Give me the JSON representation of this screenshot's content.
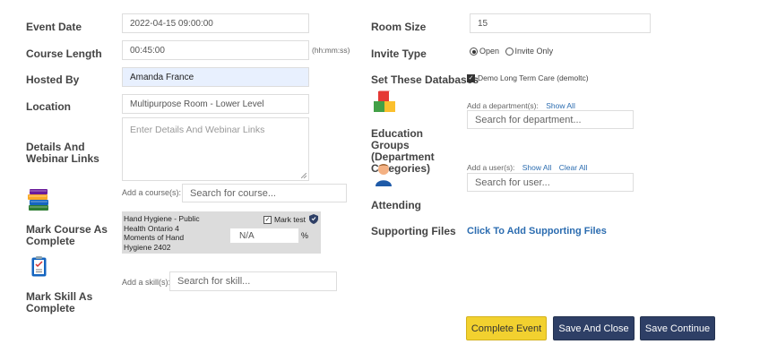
{
  "labels": {
    "event_date": "Event Date",
    "course_length": "Course Length",
    "hosted_by": "Hosted By",
    "location": "Location",
    "details": "Details And Webinar Links",
    "mark_course": "Mark Course As Complete",
    "mark_skill": "Mark Skill As Complete",
    "room_size": "Room Size",
    "invite_type": "Invite Type",
    "set_databases": "Set These Databases",
    "education_groups": "Education Groups (Department Categories)",
    "attending": "Attending",
    "supporting_files": "Supporting Files"
  },
  "fields": {
    "event_date": "2022-04-15 09:00:00",
    "course_length": "00:45:00",
    "course_length_hint": "(hh:mm:ss)",
    "hosted_by": "Amanda France",
    "location": "Multipurpose Room - Lower Level",
    "details_placeholder": "Enter Details And Webinar Links",
    "room_size": "15"
  },
  "course": {
    "add_label": "Add a course(s):",
    "search_placeholder": "Search for course...",
    "item_name": "Hand Hygiene - Public Health Ontario 4 Moments of Hand Hygiene 2402",
    "mark_test_label": "Mark test",
    "score_value": "N/A",
    "score_unit": "%"
  },
  "skill": {
    "add_label": "Add a skill(s):",
    "search_placeholder": "Search for skill..."
  },
  "invite": {
    "open": "Open",
    "invite_only": "Invite Only",
    "selected": "Open"
  },
  "databases": {
    "item": "Demo Long Term Care (demoltc)"
  },
  "department": {
    "add_label": "Add a department(s):",
    "show_all": "Show All",
    "search_placeholder": "Search for department..."
  },
  "user": {
    "add_label": "Add a user(s):",
    "show_all": "Show All",
    "clear_all": "Clear All",
    "search_placeholder": "Search for user..."
  },
  "supporting_files_link": "Click To Add Supporting Files",
  "buttons": {
    "complete": "Complete Event",
    "save_close": "Save And Close",
    "save_continue": "Save Continue"
  },
  "icons": {
    "course_icon": "books-stack-icon",
    "skill_icon": "checklist-icon",
    "department_icon": "cubes-icon",
    "user_icon": "user-person-icon",
    "mark_test_badge": "shield-icon"
  },
  "colors": {
    "accent_yellow": "#f2d12f",
    "button_navy": "#2e3f66",
    "link_blue": "#2b6cb0",
    "highlight_field": "#e8f0fe"
  }
}
